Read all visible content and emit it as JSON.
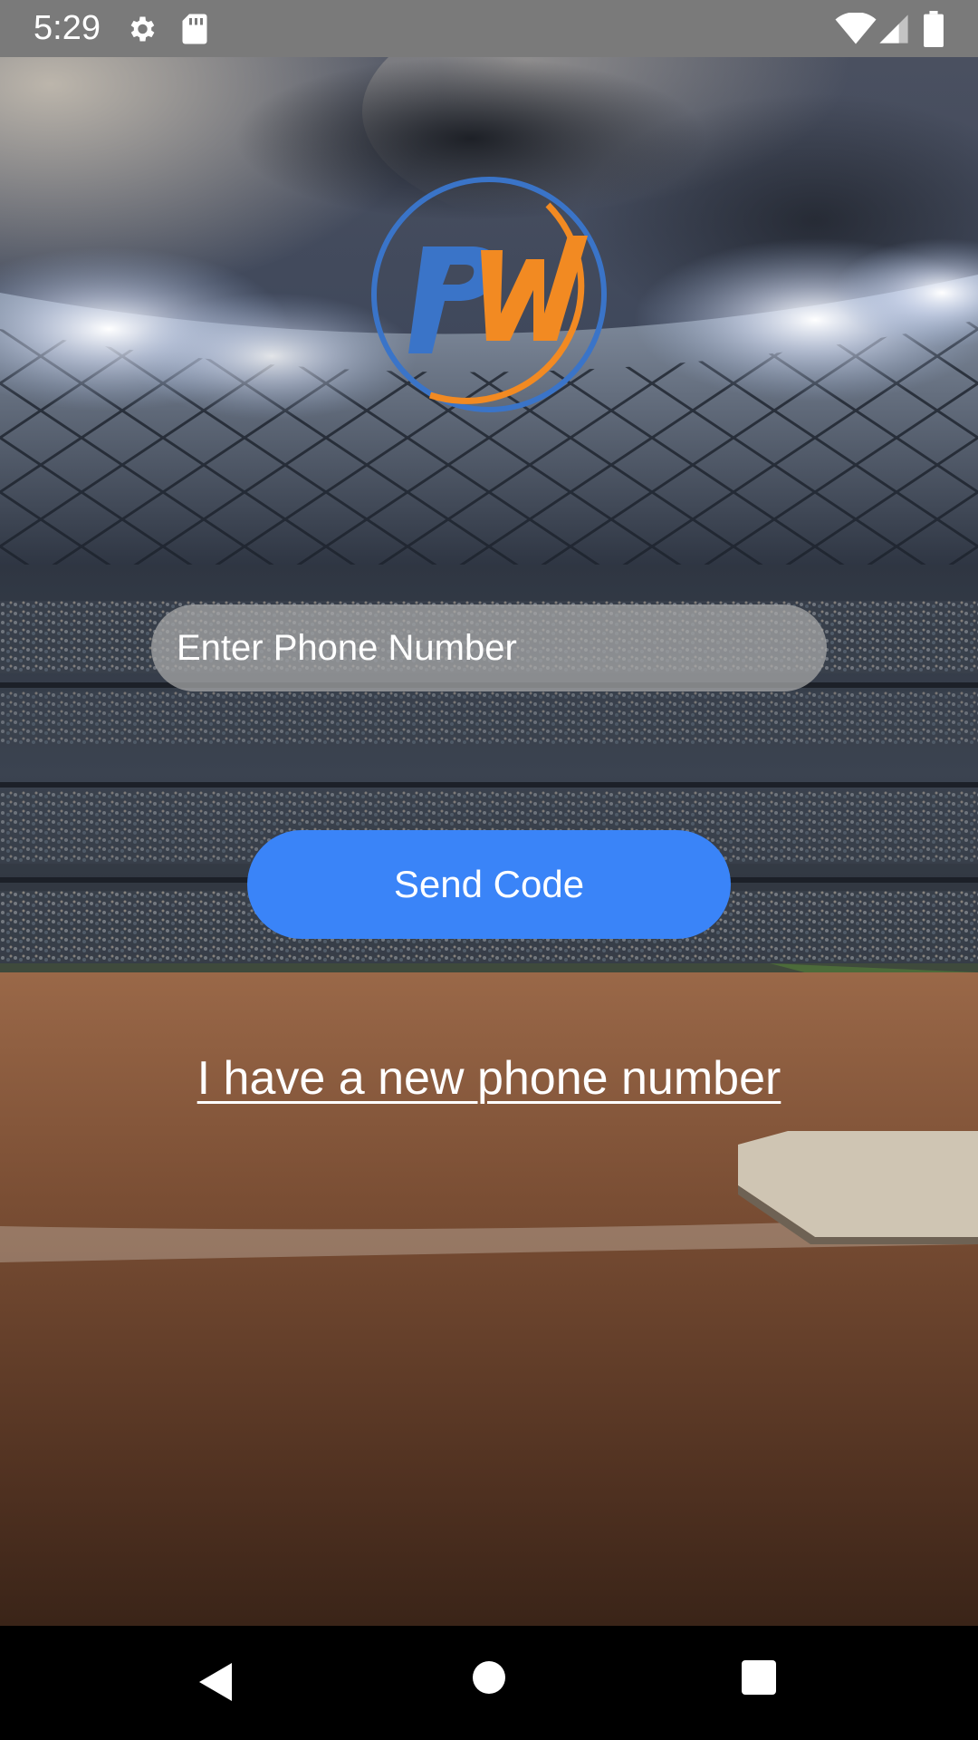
{
  "status_bar": {
    "time": "5:29",
    "icons": [
      "gear-icon",
      "sd-card-icon",
      "wifi-icon",
      "signal-icon",
      "battery-icon"
    ]
  },
  "logo": {
    "text": "PW",
    "colors": {
      "blue": "#3a74c8",
      "orange": "#f28a22"
    }
  },
  "phone_input": {
    "placeholder": "Enter Phone Number",
    "value": ""
  },
  "send_code_button": {
    "label": "Send Code",
    "color": "#3a84f8"
  },
  "new_number_link": {
    "label": "I have a new phone number"
  },
  "nav_bar": {
    "icons": [
      "back-icon",
      "home-icon",
      "recents-icon"
    ]
  }
}
